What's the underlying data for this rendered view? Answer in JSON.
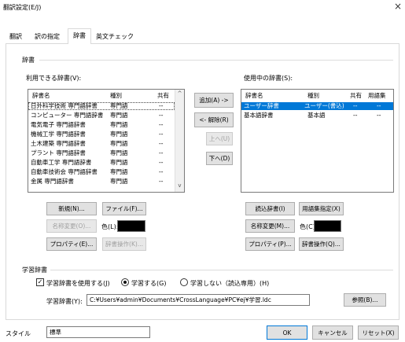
{
  "window": {
    "title": "翻訳設定(E/J)",
    "close": "×"
  },
  "tabs": [
    {
      "label": "翻訳",
      "active": false
    },
    {
      "label": "訳の指定",
      "active": false
    },
    {
      "label": "辞書",
      "active": true
    },
    {
      "label": "英文チェック",
      "active": false
    }
  ],
  "dictionary_group": {
    "label": "辞書",
    "available": {
      "label": "利用できる辞書(V):",
      "headers": [
        "辞書名",
        "種別",
        "共有",
        "^"
      ],
      "rows": [
        [
          "日外科学技術 専門語辞書",
          "専門語",
          "--"
        ],
        [
          "コンピューター 専門語辞書",
          "専門語",
          "--"
        ],
        [
          "電気電子 専門語辞書",
          "専門語",
          "--"
        ],
        [
          "機械工学 専門語辞書",
          "専門語",
          "--"
        ],
        [
          "土木建築 専門語辞書",
          "専門語",
          "--"
        ],
        [
          "プラント 専門語辞書",
          "専門語",
          "--"
        ],
        [
          "自動車工学 専門語辞書",
          "専門語",
          "--"
        ],
        [
          "自動車技術会 専門語辞書",
          "専門語",
          "--"
        ],
        [
          "金属 専門語辞書",
          "専門語",
          "--"
        ]
      ],
      "scroll_down": "v"
    },
    "in_use": {
      "label": "使用中の辞書(S):",
      "headers": [
        "辞書名",
        "種別",
        "共有",
        "用語集"
      ],
      "rows": [
        [
          "ユーザー辞書",
          "ユーザー(書込)",
          "--",
          "--"
        ],
        [
          "基本語辞書",
          "基本語",
          "--",
          "--"
        ]
      ]
    },
    "add": "追加(A) ->",
    "remove": "<- 解除(R)",
    "up": "上へ(U)",
    "down": "下へ(D)",
    "new": "新規(N)...",
    "file": "ファイル(F)...",
    "rename_left": "名称変更(O)...",
    "color_left": "色(L):",
    "properties_left": "プロパティ(E)...",
    "dict_ops_left": "辞書操作(K)...",
    "readonly_dict": "読込辞書(I)",
    "glossary_assign": "用語集指定(X)",
    "rename_right": "名称変更(M)...",
    "color_right": "色(C):",
    "properties_right": "プロパティ(P)...",
    "dict_ops_right": "辞書操作(Q)...",
    "swatch_color": "#000000"
  },
  "learning_group": {
    "label": "学習辞書",
    "use_checkbox": "学習辞書を使用する(J)",
    "use_checked": true,
    "radio_learn": "学習する(G)",
    "radio_no_learn": "学習しない（読込専用）(H)",
    "selected": "学習する(G)",
    "path_label": "学習辞書(Y):",
    "path_value": "C:¥Users¥admin¥Documents¥CrossLanguage¥PC¥ej¥学習.ldc",
    "browse": "参照(B)..."
  },
  "footer": {
    "style_label": "スタイル",
    "style_value": "標準",
    "ok": "OK",
    "cancel": "キャンセル",
    "reset": "リセット(X)"
  },
  "colors": {
    "selection": "#0078d7",
    "button_bg": "#e1e1e1",
    "border": "#adadad"
  }
}
